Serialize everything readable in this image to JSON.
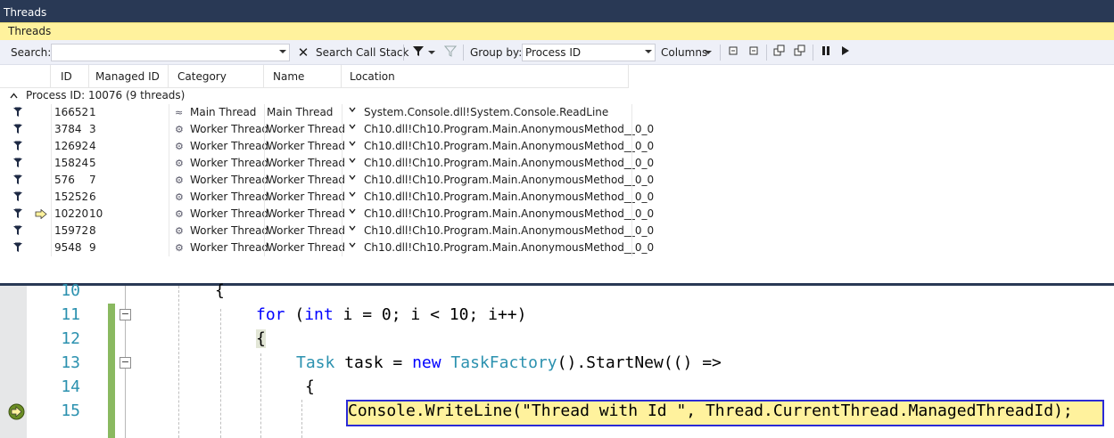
{
  "window": {
    "title": "Threads",
    "tab": "Threads"
  },
  "toolbar": {
    "search_label": "Search:",
    "search_value": "",
    "search_call_stack": "Search Call Stack",
    "group_by_label": "Group by:",
    "group_by_value": "Process ID",
    "columns_label": "Columns"
  },
  "columns": [
    "ID",
    "Managed ID",
    "Category",
    "Name",
    "Location"
  ],
  "group": {
    "label": "Process ID: 10076  (9 threads)"
  },
  "threads": [
    {
      "id": "16652",
      "managed_id": "1",
      "category": "Main Thread",
      "name": "Main Thread",
      "location": "System.Console.dll!System.Console.ReadLine",
      "current": false
    },
    {
      "id": "3784",
      "managed_id": "3",
      "category": "Worker Thread",
      "name": "Worker Thread",
      "location": "Ch10.dll!Ch10.Program.Main.AnonymousMethod__0_0",
      "current": false
    },
    {
      "id": "12692",
      "managed_id": "4",
      "category": "Worker Thread",
      "name": "Worker Thread",
      "location": "Ch10.dll!Ch10.Program.Main.AnonymousMethod__0_0",
      "current": false
    },
    {
      "id": "15824",
      "managed_id": "5",
      "category": "Worker Thread",
      "name": "Worker Thread",
      "location": "Ch10.dll!Ch10.Program.Main.AnonymousMethod__0_0",
      "current": false
    },
    {
      "id": "576",
      "managed_id": "7",
      "category": "Worker Thread",
      "name": "Worker Thread",
      "location": "Ch10.dll!Ch10.Program.Main.AnonymousMethod__0_0",
      "current": false
    },
    {
      "id": "15252",
      "managed_id": "6",
      "category": "Worker Thread",
      "name": "Worker Thread",
      "location": "Ch10.dll!Ch10.Program.Main.AnonymousMethod__0_0",
      "current": false
    },
    {
      "id": "10220",
      "managed_id": "10",
      "category": "Worker Thread",
      "name": "Worker Thread",
      "location": "Ch10.dll!Ch10.Program.Main.AnonymousMethod__0_0",
      "current": true
    },
    {
      "id": "15972",
      "managed_id": "8",
      "category": "Worker Thread",
      "name": "Worker Thread",
      "location": "Ch10.dll!Ch10.Program.Main.AnonymousMethod__0_0",
      "current": false
    },
    {
      "id": "9548",
      "managed_id": "9",
      "category": "Worker Thread",
      "name": "Worker Thread",
      "location": "Ch10.dll!Ch10.Program.Main.AnonymousMethod__0_0",
      "current": false
    }
  ],
  "editor": {
    "line_numbers": [
      "10",
      "11",
      "12",
      "13",
      "14",
      "15"
    ],
    "lines": {
      "l10": "{",
      "l11_kw1": "for",
      "l11_a": " (",
      "l11_kw2": "int",
      "l11_b": " i = 0; i < 10; i++)",
      "l12": "{",
      "l13_ty1": "Task",
      "l13_a": " task = ",
      "l13_kw": "new",
      "l13_sp": " ",
      "l13_ty2": "TaskFactory",
      "l13_b": "().StartNew(() =>",
      "l14": "{",
      "l15": "Console.WriteLine(\"Thread with Id \", Thread.CurrentThread.ManagedThreadId);"
    }
  },
  "colors": {
    "title_bg": "#293955",
    "tab_bg": "#fff29d",
    "keyword": "#0000ff",
    "type": "#2b91af",
    "line_number": "#2b91af",
    "change_bar": "#8ab960"
  },
  "icons": [
    "flag-icon",
    "current-thread-arrow-icon",
    "main-thread-icon",
    "worker-thread-icon",
    "expand-location-icon",
    "search-call-stack-icon",
    "filter-icon",
    "pause-icon",
    "play-icon",
    "breakpoint-arrow-icon"
  ]
}
